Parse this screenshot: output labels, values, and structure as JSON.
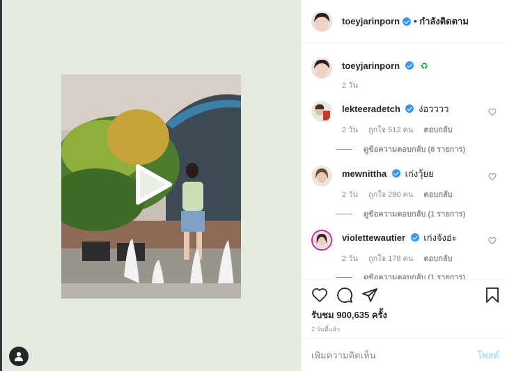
{
  "post": {
    "author": "toeyjarinporn",
    "follow_state": "• กำลังติดตาม",
    "caption_emoji": "♻",
    "caption_age": "2 วัน",
    "views_label": "รับชม 900,635 ครั้ง",
    "timestamp": "2 วันที่แล้ว"
  },
  "comments": [
    {
      "user": "lekteeradetch",
      "text": "ง่อวววว",
      "age": "2 วัน",
      "likes": "ถูกใจ 512 คน",
      "reply": "ตอบกลับ",
      "view_replies": "ดูข้อความตอบกลับ (6 รายการ)"
    },
    {
      "user": "mewnittha",
      "text": "เก่งวุ้ยย",
      "age": "2 วัน",
      "likes": "ถูกใจ 290 คน",
      "reply": "ตอบกลับ",
      "view_replies": "ดูข้อความตอบกลับ (1 รายการ)"
    },
    {
      "user": "violettewautier",
      "text": "เก่งจังอ่ะ",
      "age": "2 วัน",
      "likes": "ถูกใจ 178 คน",
      "reply": "ตอบกลับ",
      "view_replies": "ดูข้อความตอบกลับ (1 รายการ)"
    }
  ],
  "composer": {
    "placeholder": "เพิ่มความคิดเห็น",
    "post_label": "โพสต์"
  },
  "icons": {
    "like": "heart-icon",
    "comment": "comment-icon",
    "share": "paper-plane-icon",
    "save": "bookmark-icon",
    "play": "play-icon",
    "verified": "verified-badge-icon"
  },
  "colors": {
    "verified": "#3897f0",
    "post_button_disabled": "#b2dffc",
    "media_background": "#e3ebe1",
    "muted_text": "#8e8e8e"
  }
}
